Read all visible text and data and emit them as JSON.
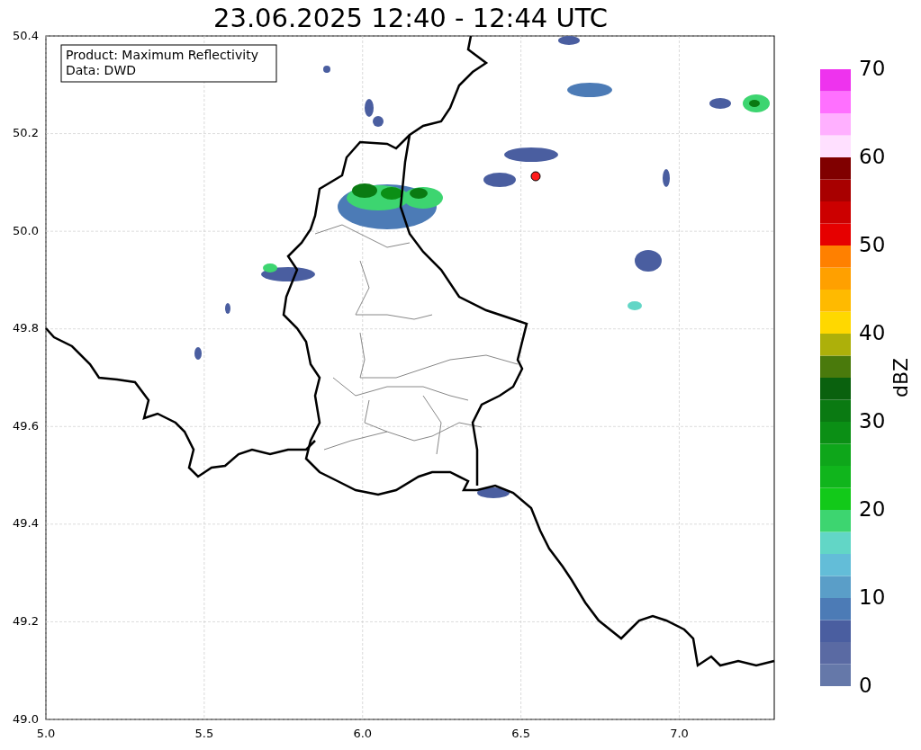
{
  "title": "23.06.2025 12:40 - 12:44 UTC",
  "legend": {
    "lines": [
      "Product: Maximum Reflectivity",
      "Data: DWD"
    ]
  },
  "map": {
    "y_ticks": [
      "50.4",
      "50.2",
      "50.0",
      "49.8",
      "49.6",
      "49.4",
      "49.2",
      "49.0"
    ],
    "x_ticks": [
      "5.0",
      "5.5",
      "6.0",
      "6.5",
      "7.0"
    ]
  },
  "colorbar": {
    "label": "dBZ",
    "ticks": [
      "70",
      "60",
      "50",
      "40",
      "30",
      "20",
      "10",
      "0"
    ],
    "bands": [
      {
        "color": "#6578a9"
      },
      {
        "color": "#5a6aa3"
      },
      {
        "color": "#4a5ea0"
      },
      {
        "color": "#4c7bb6"
      },
      {
        "color": "#5a9ec8"
      },
      {
        "color": "#63bdd8"
      },
      {
        "color": "#62d6c6"
      },
      {
        "color": "#3dd570"
      },
      {
        "color": "#12c919"
      },
      {
        "color": "#10b51c"
      },
      {
        "color": "#0ea61a"
      },
      {
        "color": "#0b8f15"
      },
      {
        "color": "#0a7a12"
      },
      {
        "color": "#0a610e"
      },
      {
        "color": "#4a7a0c"
      },
      {
        "color": "#adb00a"
      },
      {
        "color": "#ffd800"
      },
      {
        "color": "#ffba00"
      },
      {
        "color": "#ffa000"
      },
      {
        "color": "#ff8000"
      },
      {
        "color": "#e60000"
      },
      {
        "color": "#cc0000"
      },
      {
        "color": "#a80000"
      },
      {
        "color": "#800000"
      },
      {
        "color": "#ffe0ff"
      },
      {
        "color": "#ffb0ff"
      },
      {
        "color": "#ff70ff"
      },
      {
        "color": "#ee33ee"
      }
    ]
  }
}
